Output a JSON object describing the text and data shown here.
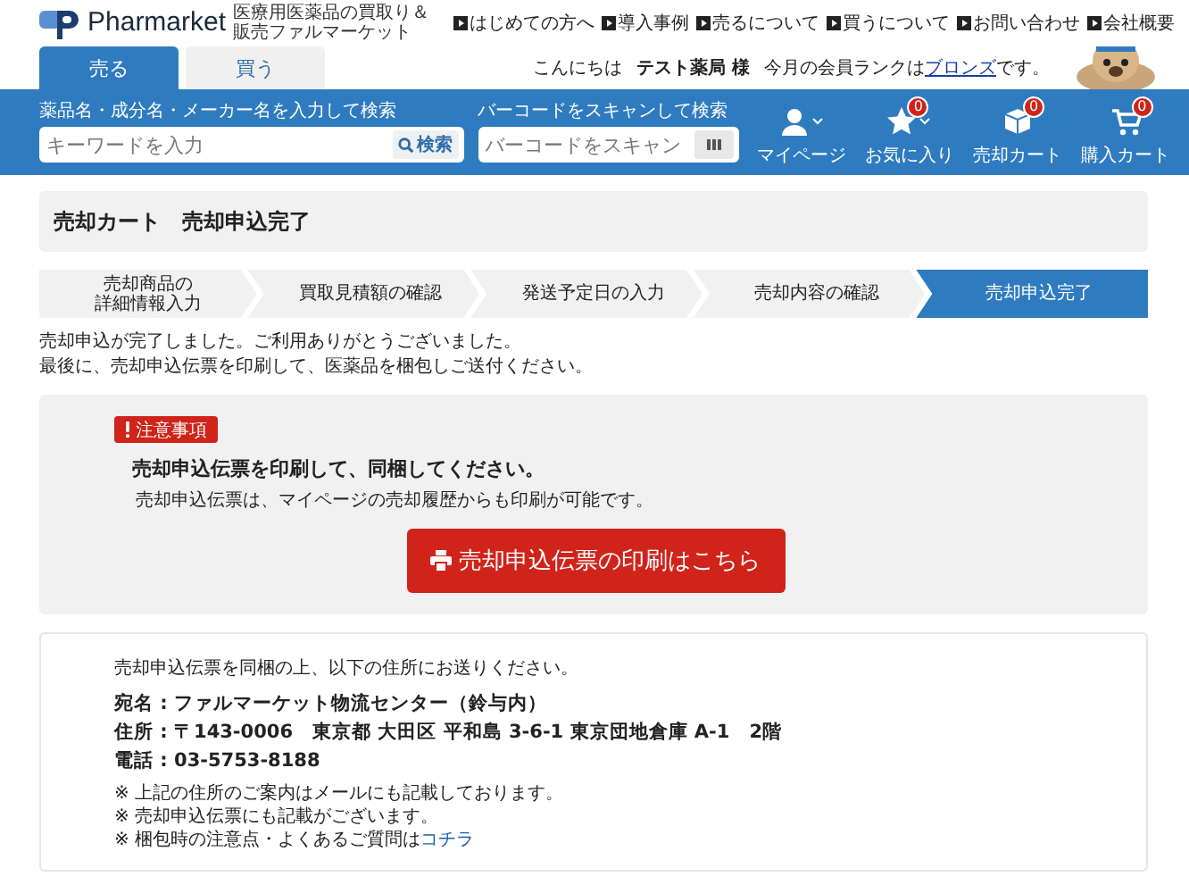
{
  "header": {
    "logo_text": "Pharmarket",
    "tagline": "医療用医薬品の買取り＆販売ファルマーケット",
    "nav_links": [
      "はじめての方へ",
      "導入事例",
      "売るについて",
      "買うについて",
      "お問い合わせ",
      "会社概要"
    ],
    "tabs": [
      {
        "label": "売る",
        "selected": true
      },
      {
        "label": "買う",
        "selected": false
      }
    ],
    "greeting": {
      "prefix": "こんにちは",
      "user": "テスト薬局 様",
      "rank_text": "今月の会員ランクは",
      "rank": "ブロンズ",
      "suffix": "です。"
    }
  },
  "search": {
    "label": "薬品名・成分名・メーカー名を入力して検索",
    "placeholder": "キーワードを入力",
    "button": "検索"
  },
  "barcode": {
    "label": "バーコードをスキャンして検索",
    "placeholder": "バーコードをスキャン"
  },
  "shortcuts": [
    {
      "kind": "user",
      "label": "マイページ",
      "dropdown": true
    },
    {
      "kind": "star",
      "label": "お気に入り",
      "badge": "0",
      "dropdown": true
    },
    {
      "kind": "box",
      "label": "売却カート",
      "badge": "0",
      "dropdown": false
    },
    {
      "kind": "cart",
      "label": "購入カート",
      "badge": "0",
      "dropdown": false
    }
  ],
  "page_title": "売却カート　売却申込完了",
  "steps": [
    {
      "lines": [
        "売却商品の",
        "詳細情報入力"
      ],
      "selected": false
    },
    {
      "lines": [
        "買取見積額の確認"
      ],
      "selected": false
    },
    {
      "lines": [
        "発送予定日の入力"
      ],
      "selected": false
    },
    {
      "lines": [
        "売却内容の確認"
      ],
      "selected": false
    },
    {
      "lines": [
        "売却申込完了"
      ],
      "selected": true
    }
  ],
  "messages": [
    "売却申込が完了しました。ご利用ありがとうございました。",
    "最後に、売却申込伝票を印刷して、医薬品を梱包しご送付ください。"
  ],
  "notice": {
    "badge": "注意事項",
    "heading": "売却申込伝票を印刷して、同梱してください。",
    "note": "売却申込伝票は、マイページの売却履歴からも印刷が可能です。",
    "button": "売却申込伝票の印刷はこちら"
  },
  "address": {
    "intro": "売却申込伝票を同梱の上、以下の住所にお送りください。",
    "lines": [
      "宛名 : ファルマーケット物流センター（鈴与内）",
      "住所 : 〒143-0006　東京都 大田区 平和島 3-6-1 東京団地倉庫 A-1　2階",
      "電話 : 03-5753-8188"
    ],
    "notes": [
      {
        "text": "※ 上記の住所のご案内はメールにも記載しております。"
      },
      {
        "text": "※ 売却申込伝票にも記載がございます。"
      },
      {
        "text": "※ 梱包時の注意点・よくあるご質問は",
        "link": "コチラ"
      }
    ]
  }
}
